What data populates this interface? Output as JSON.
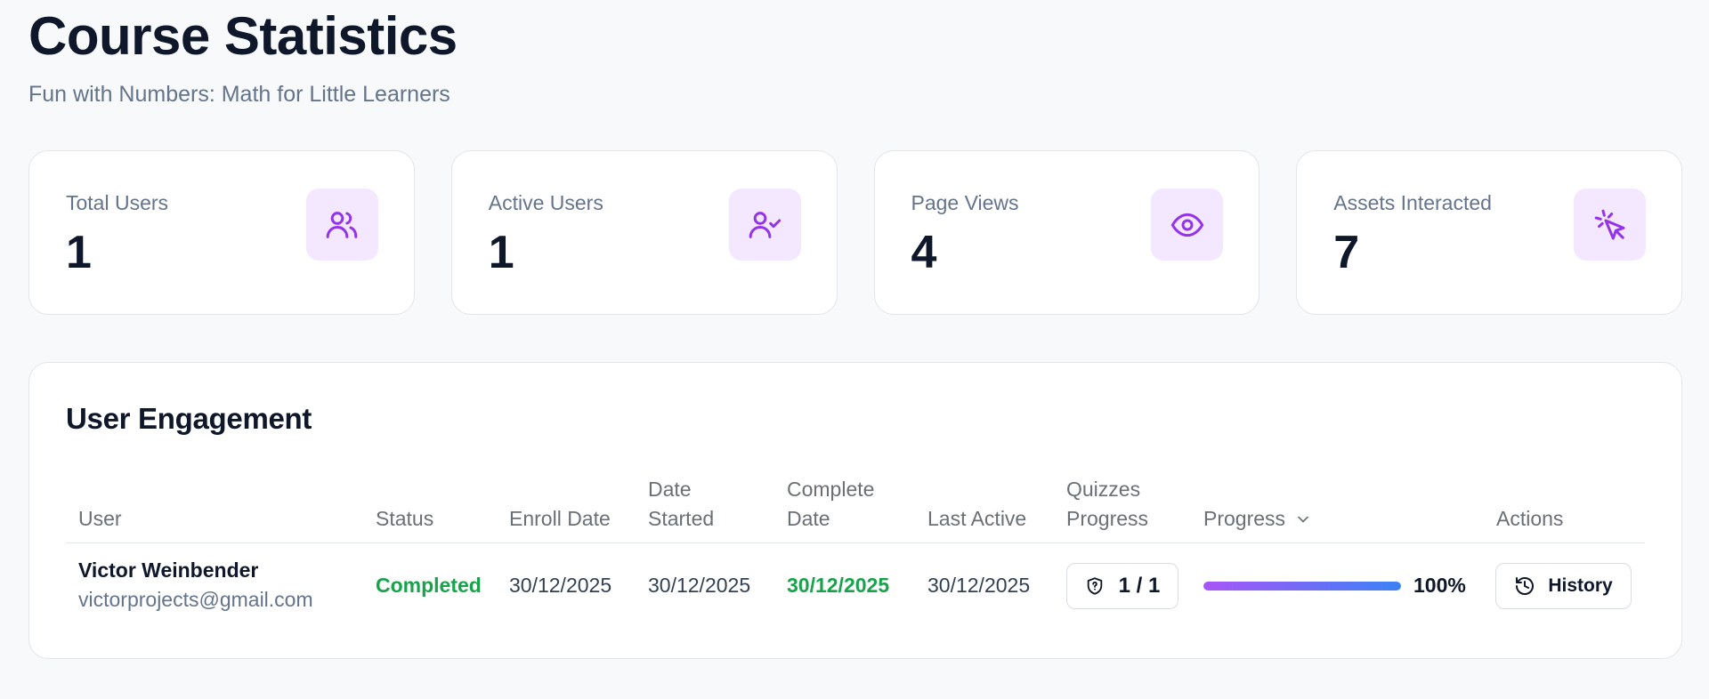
{
  "page": {
    "title": "Course Statistics",
    "subtitle": "Fun with Numbers: Math for Little Learners"
  },
  "stats": [
    {
      "label": "Total Users",
      "value": "1",
      "icon": "users-icon"
    },
    {
      "label": "Active Users",
      "value": "1",
      "icon": "user-check-icon"
    },
    {
      "label": "Page Views",
      "value": "4",
      "icon": "eye-icon"
    },
    {
      "label": "Assets Interacted",
      "value": "7",
      "icon": "cursor-click-icon"
    }
  ],
  "engagement": {
    "title": "User Engagement",
    "columns": {
      "user": "User",
      "status": "Status",
      "enroll_date": "Enroll Date",
      "date_started": "Date Started",
      "complete_date": "Complete Date",
      "last_active": "Last Active",
      "quizzes_progress": "Quizzes Progress",
      "progress": "Progress",
      "actions": "Actions"
    },
    "rows": [
      {
        "name": "Victor Weinbender",
        "email": "victorprojects@gmail.com",
        "status": "Completed",
        "enroll_date": "30/12/2025",
        "date_started": "30/12/2025",
        "complete_date": "30/12/2025",
        "last_active": "30/12/2025",
        "quizzes": "1 / 1",
        "progress_percent": 100,
        "progress_label": "100%",
        "action_label": "History"
      }
    ]
  },
  "colors": {
    "accent": "#9333ea",
    "icon_bg": "#f3e8ff",
    "status_green": "#16a34a",
    "progress_start": "#a855f7",
    "progress_end": "#3b82f6"
  }
}
